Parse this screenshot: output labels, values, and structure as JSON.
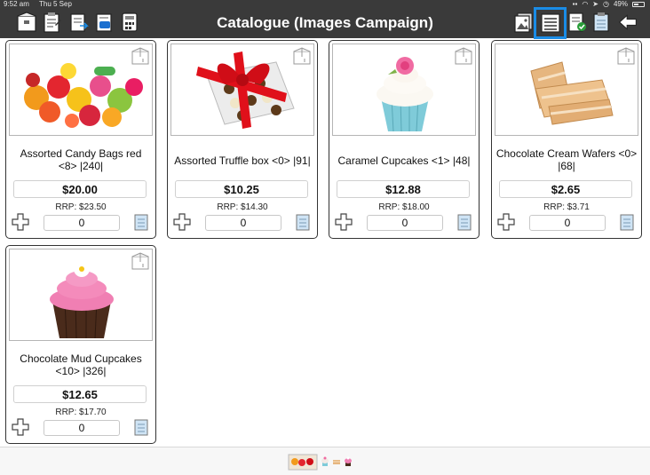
{
  "status": {
    "time": "9:52 am",
    "date": "Thu 5 Sep",
    "battery": "49%"
  },
  "header": {
    "title": "Catalogue (Images Campaign)"
  },
  "products": [
    {
      "name": "Assorted Candy Bags red <8> |240|",
      "price": "$20.00",
      "rrp": "RRP: $23.50",
      "qty": "0",
      "image": "candy-image"
    },
    {
      "name": "Assorted Truffle box <0> |91|",
      "price": "$10.25",
      "rrp": "RRP: $14.30",
      "qty": "0",
      "image": "truffle-box-image"
    },
    {
      "name": "Caramel Cupcakes <1> |48|",
      "price": "$12.88",
      "rrp": "RRP: $18.00",
      "qty": "0",
      "image": "cupcake-image"
    },
    {
      "name": "Chocolate Cream Wafers <0> |68|",
      "price": "$2.65",
      "rrp": "RRP: $3.71",
      "qty": "0",
      "image": "wafer-image"
    },
    {
      "name": "Chocolate Mud Cupcakes <10> |326|",
      "price": "$12.65",
      "rrp": "RRP: $17.70",
      "qty": "0",
      "image": "mud-cupcake-image"
    }
  ],
  "colors": {
    "header_bg": "#3a3a3a",
    "active_highlight": "#1a8ce6"
  }
}
